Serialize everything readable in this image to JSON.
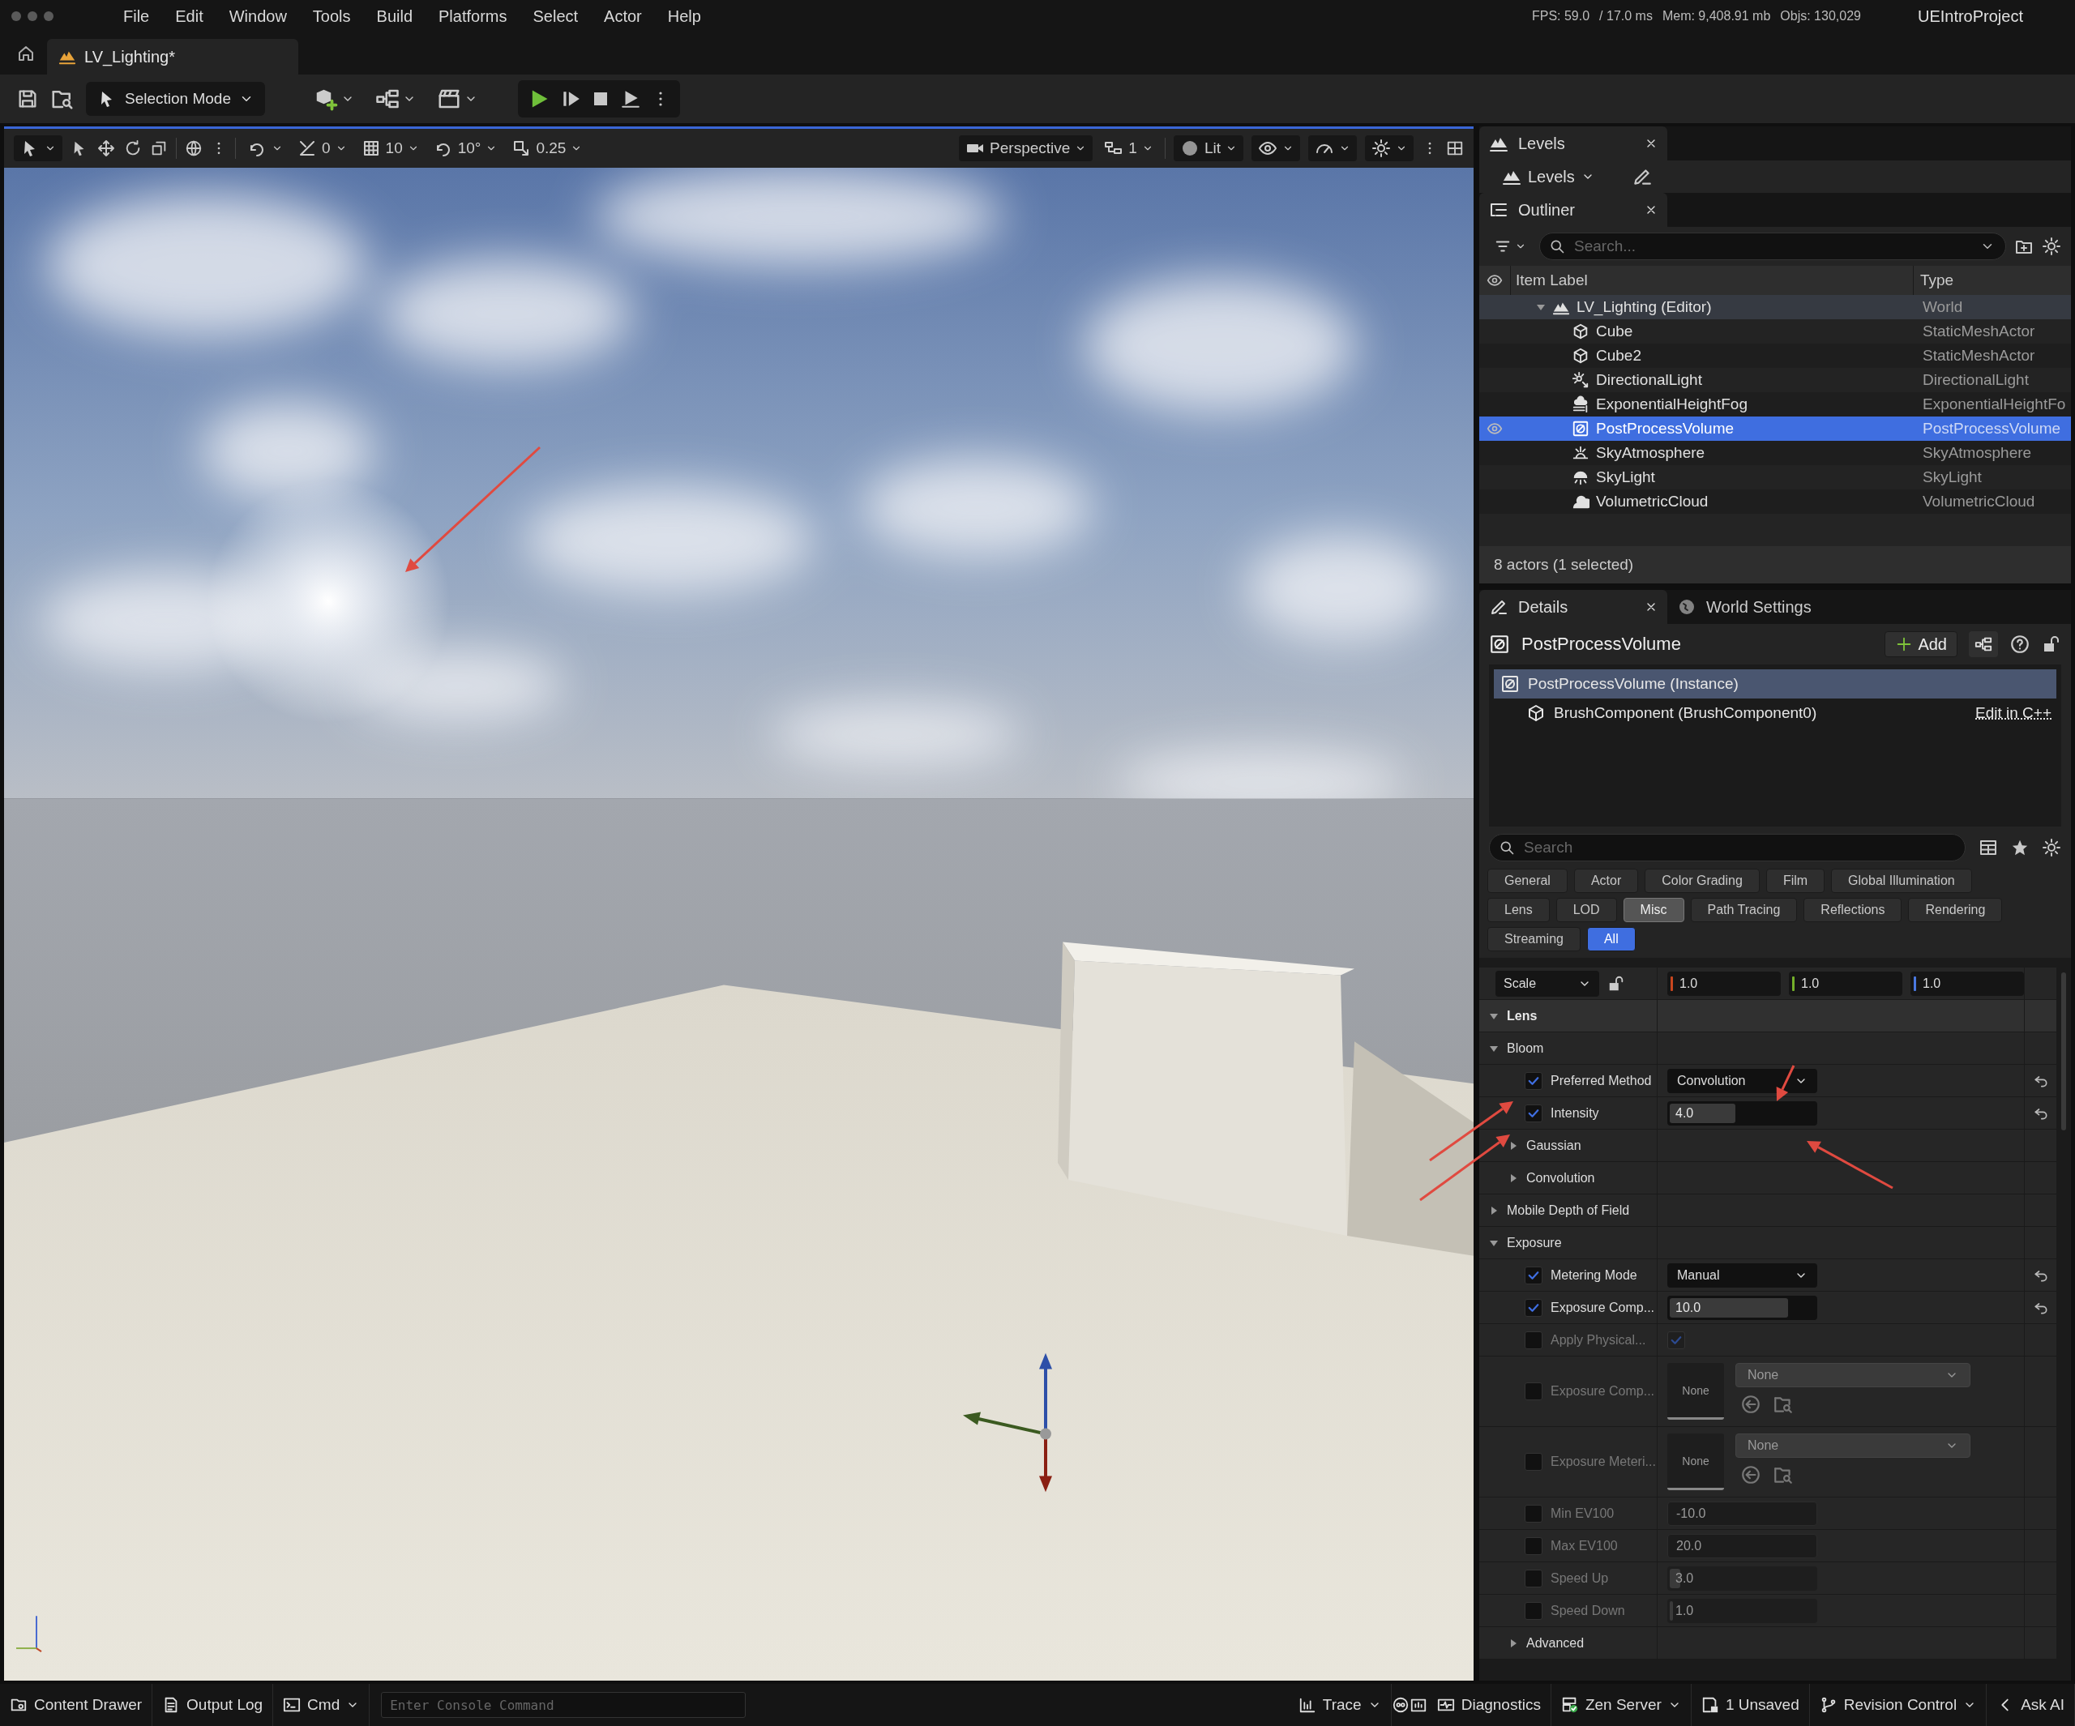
{
  "menu_bar": {
    "items": [
      "File",
      "Edit",
      "Window",
      "Tools",
      "Build",
      "Platforms",
      "Select",
      "Actor",
      "Help"
    ],
    "stats": [
      "FPS: 59.0",
      "/ 17.0 ms",
      "Mem: 9,408.91 mb",
      "Objs: 130,029"
    ],
    "project": "UEIntroProject"
  },
  "document_tab": {
    "title": "LV_Lighting*"
  },
  "main_toolbar": {
    "mode": "Selection Mode"
  },
  "viewport_toolbar": {
    "surface_snap": "0",
    "grid_snap": "10",
    "rotation_snap": "10°",
    "scale_snap": "0.25",
    "view": "Perspective",
    "layout": "1",
    "view_mode": "Lit"
  },
  "levels": {
    "tab": "Levels",
    "dropdown": "Levels"
  },
  "outliner": {
    "tab": "Outliner",
    "search": {
      "placeholder": "Search..."
    },
    "columns": [
      "Item Label",
      "Type"
    ],
    "rows": [
      {
        "label": "LV_Lighting (Editor)",
        "type": "World",
        "kind": "world",
        "expanded": true,
        "selected": false,
        "children": [
          {
            "label": "Cube",
            "type": "StaticMeshActor",
            "kind": "mesh",
            "selected": false
          },
          {
            "label": "Cube2",
            "type": "StaticMeshActor",
            "kind": "mesh",
            "selected": false
          },
          {
            "label": "DirectionalLight",
            "type": "DirectionalLight",
            "kind": "light",
            "selected": false
          },
          {
            "label": "ExponentialHeightFog",
            "type": "ExponentialHeightFo",
            "kind": "fog",
            "selected": false
          },
          {
            "label": "PostProcessVolume",
            "type": "PostProcessVolume",
            "kind": "volume",
            "selected": true
          },
          {
            "label": "SkyAtmosphere",
            "type": "SkyAtmosphere",
            "kind": "atmosphere",
            "selected": false
          },
          {
            "label": "SkyLight",
            "type": "SkyLight",
            "kind": "skylight",
            "selected": false
          },
          {
            "label": "VolumetricCloud",
            "type": "VolumetricCloud",
            "kind": "cloud",
            "selected": false
          }
        ]
      }
    ],
    "status": "8 actors (1 selected)"
  },
  "details": {
    "tabs": [
      {
        "label": "Details",
        "selected": true
      },
      {
        "label": "World Settings",
        "selected": false
      }
    ],
    "actor": "PostProcessVolume",
    "add_button": "Add",
    "components": [
      {
        "label": "PostProcessVolume (Instance)",
        "selected": true
      },
      {
        "label": "BrushComponent (BrushComponent0)",
        "selected": false,
        "link": "Edit in C++"
      }
    ],
    "search": {
      "placeholder": "Search"
    },
    "filters": [
      {
        "label": "General",
        "selected": false,
        "hovered": false
      },
      {
        "label": "Actor",
        "selected": false,
        "hovered": false
      },
      {
        "label": "Color Grading",
        "selected": false,
        "hovered": false
      },
      {
        "label": "Film",
        "selected": false,
        "hovered": false
      },
      {
        "label": "Global Illumination",
        "selected": false,
        "hovered": false
      },
      {
        "label": "Lens",
        "selected": false,
        "hovered": false
      },
      {
        "label": "LOD",
        "selected": false,
        "hovered": false
      },
      {
        "label": "Misc",
        "selected": false,
        "hovered": true
      },
      {
        "label": "Path Tracing",
        "selected": false,
        "hovered": false
      },
      {
        "label": "Reflections",
        "selected": false,
        "hovered": false
      },
      {
        "label": "Rendering",
        "selected": false,
        "hovered": false
      },
      {
        "label": "Streaming",
        "selected": false,
        "hovered": false
      },
      {
        "label": "All",
        "selected": true,
        "hovered": false
      }
    ],
    "properties": [
      {
        "kind": "transform",
        "label": "Scale",
        "values": [
          "1.0",
          "1.0",
          "1.0"
        ]
      },
      {
        "kind": "category",
        "label": "Lens",
        "expanded": true,
        "children": [
          {
            "kind": "group",
            "label": "Bloom",
            "expanded": true,
            "children": [
              {
                "kind": "dropdown",
                "label": "Preferred Method",
                "checked": true,
                "value": "Convolution",
                "modified": true
              },
              {
                "kind": "slider",
                "label": "Intensity",
                "checked": true,
                "value": "4.0",
                "level": 0.47,
                "modified": true
              },
              {
                "kind": "group",
                "label": "Gaussian",
                "expanded": false
              },
              {
                "kind": "group",
                "label": "Convolution",
                "expanded": false
              }
            ]
          },
          {
            "kind": "group",
            "label": "Mobile Depth of Field",
            "expanded": false
          },
          {
            "kind": "group",
            "label": "Exposure",
            "expanded": true,
            "children": [
              {
                "kind": "dropdown",
                "label": "Metering Mode",
                "checked": true,
                "value": "Manual",
                "modified": true
              },
              {
                "kind": "slider",
                "label": "Exposure Comp...",
                "checked": true,
                "value": "10.0",
                "level": 0.82,
                "modified": true
              },
              {
                "kind": "toggle",
                "label": "Apply Physical...",
                "checked": false,
                "value_checked": true,
                "modified": false
              },
              {
                "kind": "asset",
                "label": "Exposure Comp...",
                "checked": false,
                "thumbnail": "None",
                "value": "None",
                "modified": false
              },
              {
                "kind": "asset",
                "label": "Exposure Meteri...",
                "checked": false,
                "thumbnail": "None",
                "value": "None",
                "modified": false
              },
              {
                "kind": "number",
                "label": "Min EV100",
                "checked": false,
                "value": "-10.0",
                "modified": false
              },
              {
                "kind": "number",
                "label": "Max EV100",
                "checked": false,
                "value": "20.0",
                "modified": false
              },
              {
                "kind": "slider",
                "label": "Speed Up",
                "checked": false,
                "value": "3.0",
                "level": 0.1,
                "modified": false
              },
              {
                "kind": "slider",
                "label": "Speed Down",
                "checked": false,
                "value": "1.0",
                "level": 0.02,
                "modified": false
              },
              {
                "kind": "group",
                "label": "Advanced",
                "expanded": false
              }
            ]
          }
        ]
      }
    ]
  },
  "status_bar": {
    "content_drawer": "Content Drawer",
    "output_log": "Output Log",
    "cmd": "Cmd",
    "console": {
      "placeholder": "Enter Console Command"
    },
    "trace": "Trace",
    "diagnostics": "Diagnostics",
    "zen_server": "Zen Server",
    "unsaved": "1 Unsaved",
    "revision_control": "Revision Control",
    "ask_ai": "Ask AI"
  }
}
